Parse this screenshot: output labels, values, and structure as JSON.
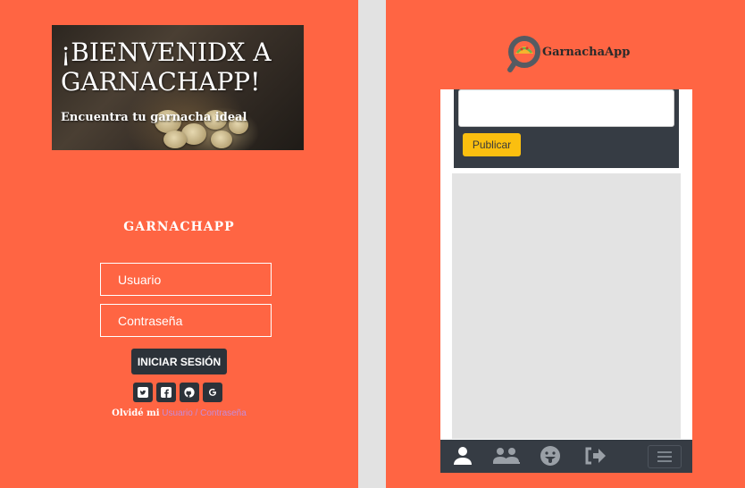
{
  "login": {
    "hero": {
      "title": "¡BIENVENIDX A GARNACHAPP!",
      "subtitle": "Encuentra tu garnacha ideal"
    },
    "brand_heading": "GARNACHAPP",
    "username_placeholder": "Usuario",
    "password_placeholder": "Contraseña",
    "login_button": "INICIAR SESIÓN",
    "social_icons": [
      "twitter-icon",
      "facebook-icon",
      "github-icon",
      "google-icon"
    ],
    "forgot": {
      "lead": "Olvidé mi",
      "user_link": "Usuario",
      "separator": "/",
      "password_link": "Contraseña"
    }
  },
  "app": {
    "title": "GarnachaApp",
    "composer": {
      "publish_button": "Publicar"
    },
    "bottom_nav": [
      "user-icon",
      "users-icon",
      "emoji-icon",
      "logout-icon",
      "menu-icon"
    ]
  },
  "colors": {
    "background": "#ff6543",
    "dark": "#2c3239",
    "accent": "#fbbf0f",
    "link": "#c68bd8"
  }
}
